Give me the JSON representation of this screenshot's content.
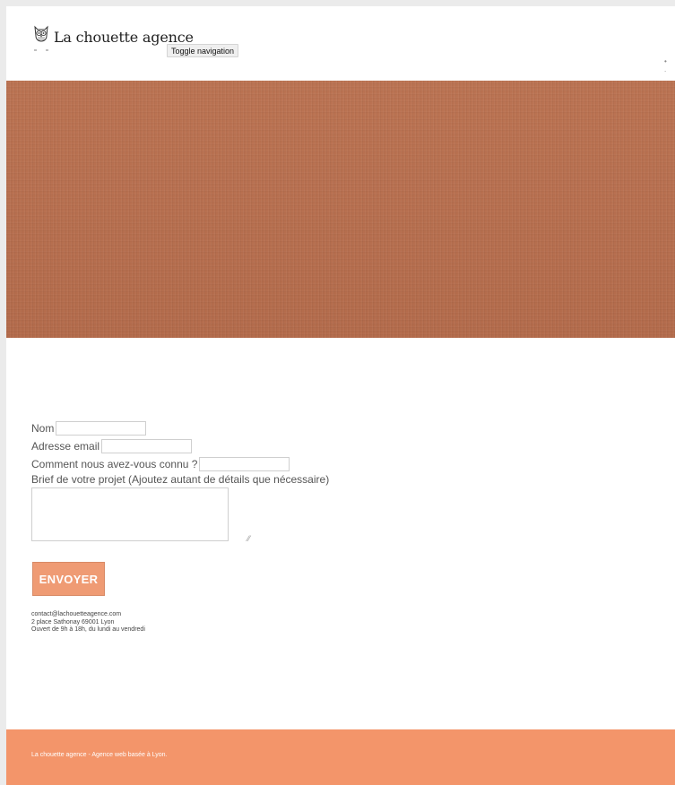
{
  "header": {
    "brand_name": "La chouette agence",
    "toggle_label": "Toggle navigation",
    "nav_dots": "• ."
  },
  "form": {
    "name_label": "Nom",
    "email_label": "Adresse email",
    "source_label": "Comment nous avez-vous connu ?",
    "brief_label": "Brief de votre projet (Ajoutez autant de détails que nécessaire)",
    "name_value": "",
    "email_value": "",
    "source_value": "",
    "brief_value": "",
    "submit_label": "ENVOYER"
  },
  "contact": {
    "email": "contact@lachouetteagence.com",
    "address": "2 place Sathonay 69001 Lyon",
    "hours": "Ouvert de 9h à 18h, du lundi au vendredi"
  },
  "footer": {
    "text": "La chouette agence - Agence web basée à Lyon."
  },
  "colors": {
    "hero": "#b97151",
    "accent": "#f3956a",
    "button": "#ef9b74"
  },
  "icons": {
    "logo": "owl-logo-icon",
    "resize": "resize-grip-icon"
  }
}
